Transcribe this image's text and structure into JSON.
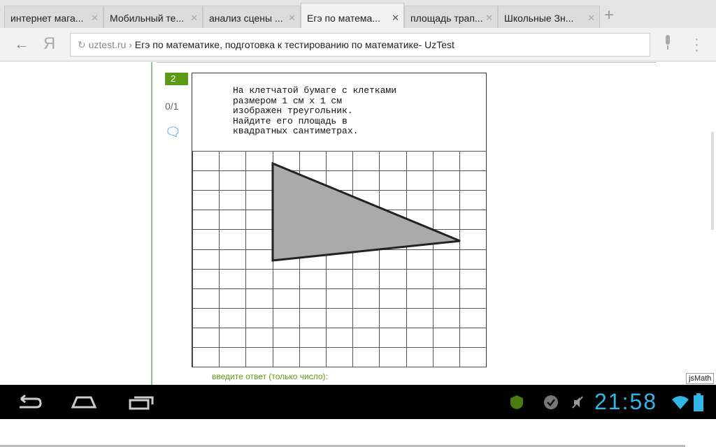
{
  "tabs": [
    {
      "label": "интернет мага...",
      "active": false
    },
    {
      "label": "Мобильный те...",
      "active": false
    },
    {
      "label": "анализ сцены ...",
      "active": false
    },
    {
      "label": "Егэ по матема...",
      "active": true
    },
    {
      "label": "площадь трап...",
      "active": false
    },
    {
      "label": "Школьные Зн...",
      "active": false
    }
  ],
  "new_tab": "+",
  "omnibox": {
    "host": "uztest.ru",
    "separator": "›",
    "title": "Егэ по математике, подготовка к тестированию по математике- UzTest"
  },
  "question": {
    "number": "2",
    "score": "0/1",
    "text": "На клетчатой бумаге с клетками\nразмером 1 см х 1 см\nизображен треугольник.\nНайдите его площадь в\nквадратных сантиметрах.",
    "answer_prompt": "введите ответ (только число):"
  },
  "jsmath": "jsMath",
  "status": {
    "time": "21:58"
  },
  "colors": {
    "accent": "#5b9a14",
    "clock": "#33b5e5"
  }
}
